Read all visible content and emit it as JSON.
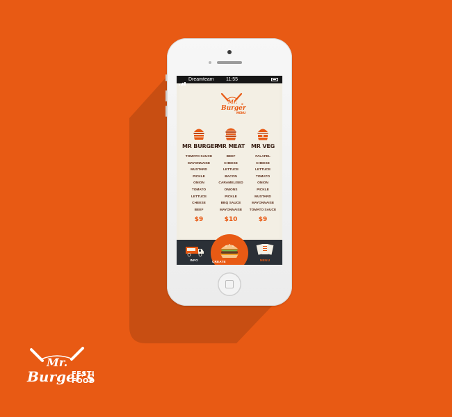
{
  "status_bar": {
    "carrier": "Dreamteam",
    "time": "11:55"
  },
  "app_logo": {
    "script": "Mr. Burger's",
    "tag": "MENU"
  },
  "menu": [
    {
      "title": "MR BURGER",
      "items": [
        "TOMATO SAUCE",
        "MAYONNAISE",
        "MUSTARD",
        "PICKLE",
        "ONION",
        "TOMATO",
        "LETTUCE",
        "CHEESE",
        "BEEF"
      ],
      "price": "$9"
    },
    {
      "title": "MR MEAT",
      "items": [
        "BEEF",
        "CHEESE",
        "LETTUCE",
        "BACON",
        "CARAMELISED",
        "ONIONS",
        "PICKLE",
        "BBQ SAUCE",
        "MAYONNAISE"
      ],
      "price": "$10"
    },
    {
      "title": "MR VEG",
      "items": [
        "FALAFEL",
        "CHEESE",
        "LETTUCE",
        "TOMATO",
        "ONION",
        "PICKLE",
        "MUSTARD",
        "MAYONNAISE",
        "TOMATO SAUCE"
      ],
      "price": "$9"
    }
  ],
  "tabs": {
    "info": "INFO",
    "create": "CREATE",
    "menu": "MENU"
  },
  "brand": {
    "script_top": "Mr.",
    "script_bottom": "Burger's",
    "line1": "FESTI",
    "line2": "FOOD"
  },
  "colors": {
    "background": "#e85a14",
    "accent": "#e85a14",
    "screen": "#f1ede2",
    "tab_bar": "#2b3037",
    "text_dark": "#3a2217"
  },
  "icons": {
    "menu_item": "burger-icon",
    "info_tab": "food-truck-icon",
    "create_tab": "burger-icon",
    "menu_tab": "menu-cards-icon"
  }
}
